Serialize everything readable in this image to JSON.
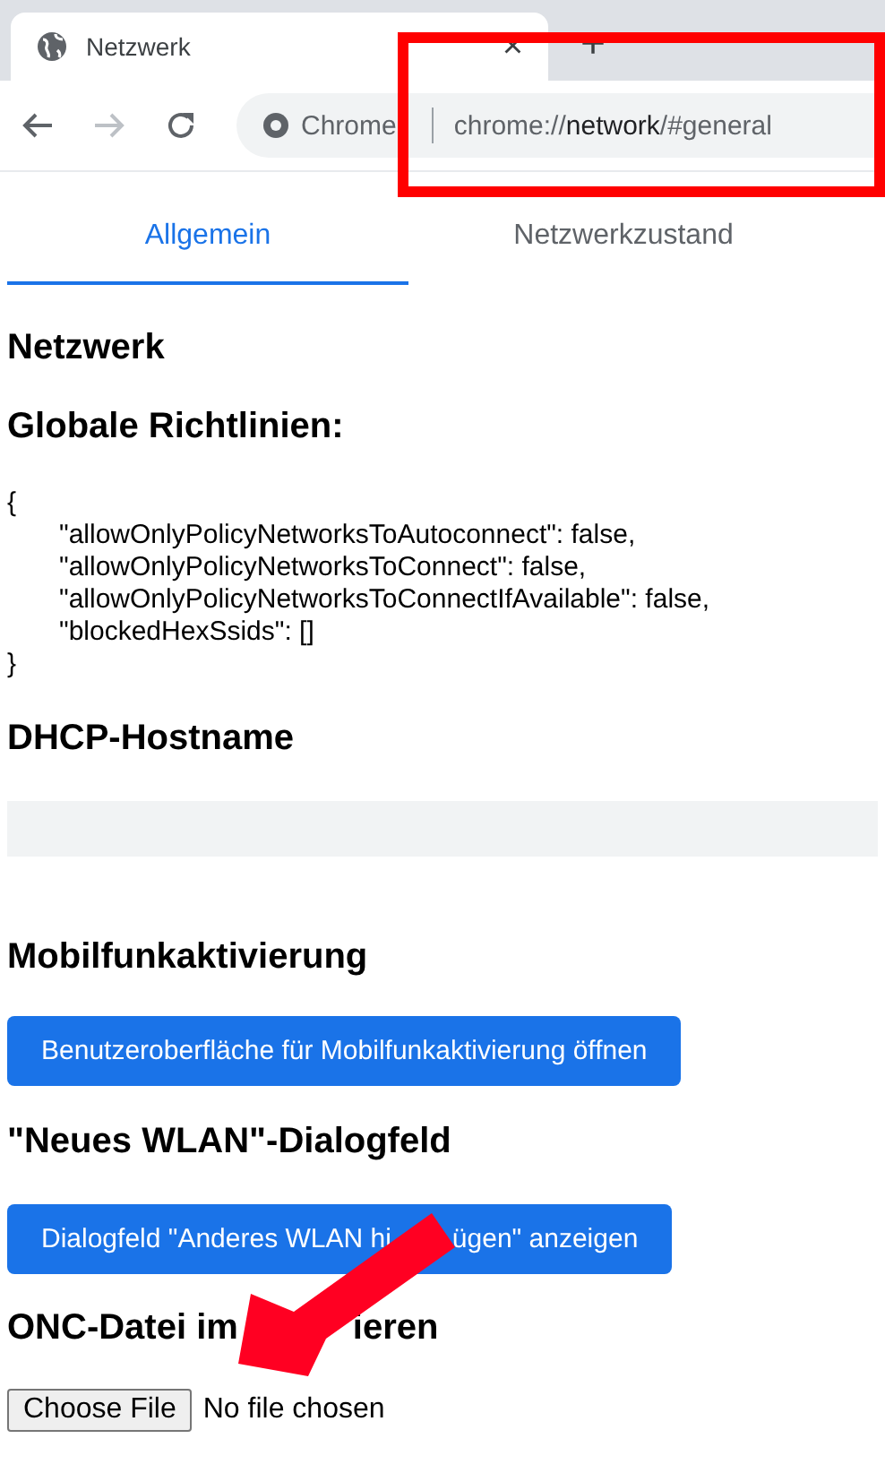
{
  "browser": {
    "tab_title": "Netzwerk",
    "close_glyph": "×",
    "new_tab_glyph": "+",
    "site_label": "Chrome",
    "url_prefix": "chrome://",
    "url_host": "network",
    "url_rest": "/#general"
  },
  "tabs": [
    {
      "label": "Allgemein",
      "selected": true
    },
    {
      "label": "Netzwerkzustand",
      "selected": false
    }
  ],
  "page_title": "Netzwerk",
  "policies": {
    "heading": "Globale Richtlinien:",
    "open": "{",
    "lines": [
      "\"allowOnlyPolicyNetworksToAutoconnect\": false,",
      "\"allowOnlyPolicyNetworksToConnect\": false,",
      "\"allowOnlyPolicyNetworksToConnectIfAvailable\": false,",
      "\"blockedHexSsids\": []"
    ],
    "close": "}"
  },
  "dhcp": {
    "heading": "DHCP-Hostname"
  },
  "sections": [
    {
      "heading": "Mobilfunkaktivierung",
      "button": "Benutzeroberfläche für Mobilfunkaktivierung öffnen"
    },
    {
      "heading": "\"Neues WLAN\"-Dialogfeld",
      "button": "Dialogfeld \"Anderes WLAN hi",
      "button_rest": "ügen\" anzeigen"
    }
  ],
  "onc": {
    "heading": "ONC-Datei im",
    "heading_rest": "ieren",
    "button": "Choose File",
    "status": "No file chosen"
  }
}
